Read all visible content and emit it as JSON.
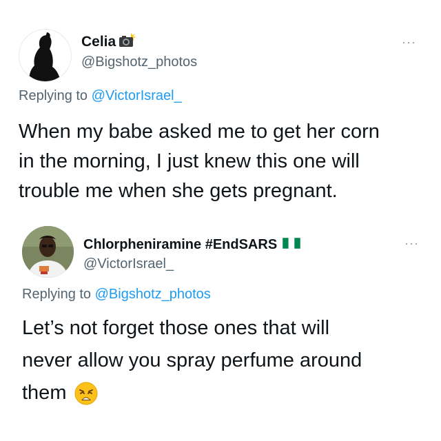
{
  "tweets": [
    {
      "display_name": "Celia",
      "name_icon": "camera-flash-icon",
      "handle": "@Bigshotz_photos",
      "replying_prefix": "Replying to",
      "replying_to": "@VictorIsrael_",
      "text_lines": [
        "When my babe asked me to get her corn",
        "in the morning, I just knew this one will",
        "trouble me when she gets pregnant."
      ],
      "more_icon": "more-options-icon",
      "more_label": "···"
    },
    {
      "display_name": "Chlorpheniramine #EndSARS",
      "name_icon": "nigeria-flag-icon",
      "handle": "@VictorIsrael_",
      "replying_prefix": "Replying to",
      "replying_to": "@Bigshotz_photos",
      "text_lines": [
        "Let’s not forget those ones that will",
        "never allow you spray perfume around",
        "them"
      ],
      "text_emoji": "weary-face-emoji",
      "more_icon": "more-options-icon",
      "more_label": "···"
    }
  ],
  "colors": {
    "text": "#0f1419",
    "secondary": "#536471",
    "link": "#1d9bf0",
    "flag_green": "#008751"
  }
}
